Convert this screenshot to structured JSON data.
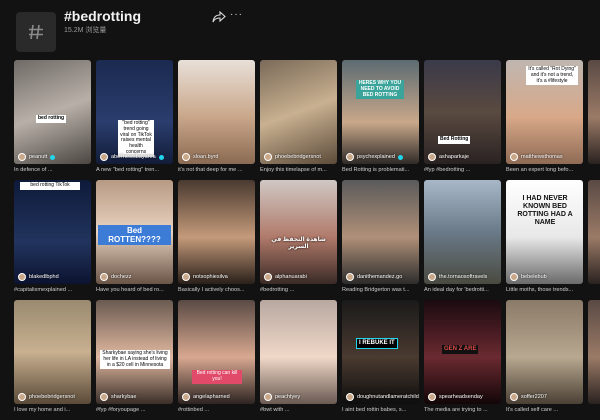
{
  "header": {
    "title": "#bedrotting",
    "meta": "15.2M 浏览量",
    "share_icon": "share-icon",
    "more_icon": "more-icon",
    "more_label": "···"
  },
  "videos": [
    {
      "user": "peanutt",
      "caption": "In defence of ...",
      "overlay": "bed rotting",
      "verified": true
    },
    {
      "user": "abc7newsbayarea",
      "caption": "A new \"bed rotting\" tren...",
      "overlay": "\"bed rotting\" trend going viral on TikTok raises mental health concerns",
      "verified": true
    },
    {
      "user": "sloan.byrd",
      "caption": "it's not that deep for me ...",
      "overlay": "",
      "verified": false
    },
    {
      "user": "phoebebridgersnot",
      "caption": "Enjoy this timelapse of m...",
      "overlay": "",
      "verified": false
    },
    {
      "user": "psychexplained",
      "caption": "Bed Rotting is problemati...",
      "overlay": "HERES WHY YOU NEED TO AVOID BED ROTTING",
      "verified": true
    },
    {
      "user": "ashaparkaje",
      "caption": "#fyp #bedrotting ...",
      "overlay": "Bed Rotting",
      "verified": false
    },
    {
      "user": "matthewsthomas",
      "caption": "Been an expert long befo...",
      "overlay": "It's called \"Rot Dying\" and it's not a trend, it's a #lifestyle",
      "verified": false
    },
    {
      "user": "blakedlbphd",
      "caption": "#capitalismexplained ...",
      "overlay": "bed rotting TikTok",
      "verified": false
    },
    {
      "user": "dochezz",
      "caption": "Have you heard of bed ro...",
      "overlay": "Bed ROTTEN????",
      "verified": false
    },
    {
      "user": "notsophiesilva",
      "caption": "Basically I actively choos...",
      "overlay": "",
      "verified": false
    },
    {
      "user": "alphanuarabi",
      "caption": "#bedrotting ...",
      "overlay": "شاهدة التحفظ في السرير",
      "verified": false
    },
    {
      "user": "danithemandez.go",
      "caption": "Reading Bridgerton was t...",
      "overlay": "",
      "verified": false
    },
    {
      "user": "the.tornaosoftravels",
      "caption": "An ideal day for 'bedrotti...",
      "overlay": "",
      "verified": false
    },
    {
      "user": "bebelebub",
      "caption": "Little moths, those trends...",
      "overlay": "I HAD NEVER KNOWN BED ROTTING HAD A NAME",
      "verified": false
    },
    {
      "user": "phoebebridgersnot",
      "caption": "I love my home and i...",
      "overlay": "",
      "verified": false
    },
    {
      "user": "sharkybae",
      "caption": "#fyp #foryoupage ...",
      "overlay": "Sharkybae saying she's living her life in LA instead of living in a $20 cell in Minnesota",
      "verified": false
    },
    {
      "user": "angelapharned",
      "caption": "#rottinbed ...",
      "overlay": "Bed rotting can kill you!",
      "verified": false
    },
    {
      "user": "peachtyey",
      "caption": "#bwt with ...",
      "overlay": "",
      "verified": false
    },
    {
      "user": "doughnutandlameratchild",
      "caption": "I aint bed rottin babes, s...",
      "overlay": "I REBUKE IT",
      "verified": false
    },
    {
      "user": "spearheadsenday",
      "caption": "The media are trying to ...",
      "overlay": "GEN Z ARE",
      "verified": false
    },
    {
      "user": "soffer2207",
      "caption": "It's called self care ...",
      "overlay": "",
      "verified": false
    }
  ]
}
